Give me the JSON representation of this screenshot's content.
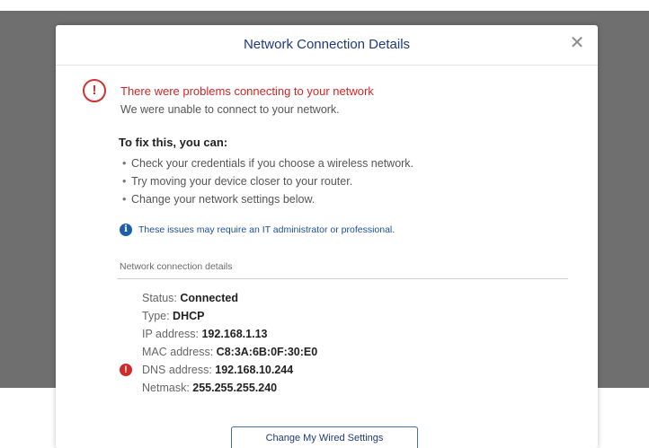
{
  "dialog": {
    "title": "Network Connection Details",
    "close_icon": "close-icon"
  },
  "error": {
    "icon": "alert-circle-icon",
    "title": "There were problems connecting to your network",
    "subtitle": "We were unable to connect to your network."
  },
  "fix": {
    "heading": "To fix this, you can:",
    "items": [
      "Check your credentials if you choose a wireless network.",
      "Try moving your device closer to your router.",
      "Change your network settings below."
    ]
  },
  "info": {
    "icon": "info-icon",
    "text": "These issues may require an IT administrator or professional."
  },
  "details": {
    "section_title": "Network connection details",
    "rows": [
      {
        "label": "Status: ",
        "value": "Connected"
      },
      {
        "label": "Type: ",
        "value": "DHCP"
      },
      {
        "label": "IP address: ",
        "value": "192.168.1.13"
      },
      {
        "label": "MAC address: ",
        "value": "C8:3A:6B:0F:30:E0"
      },
      {
        "label": "DNS address: ",
        "value": "192.168.10.244"
      },
      {
        "label": "Netmask: ",
        "value": "255.255.255.240"
      }
    ]
  },
  "actions": {
    "change_wired_label": "Change My Wired Settings"
  },
  "colors": {
    "overlay": "#6f6f6f",
    "title": "#1f3a78",
    "error": "#d22525",
    "info": "#1d5fa8"
  }
}
